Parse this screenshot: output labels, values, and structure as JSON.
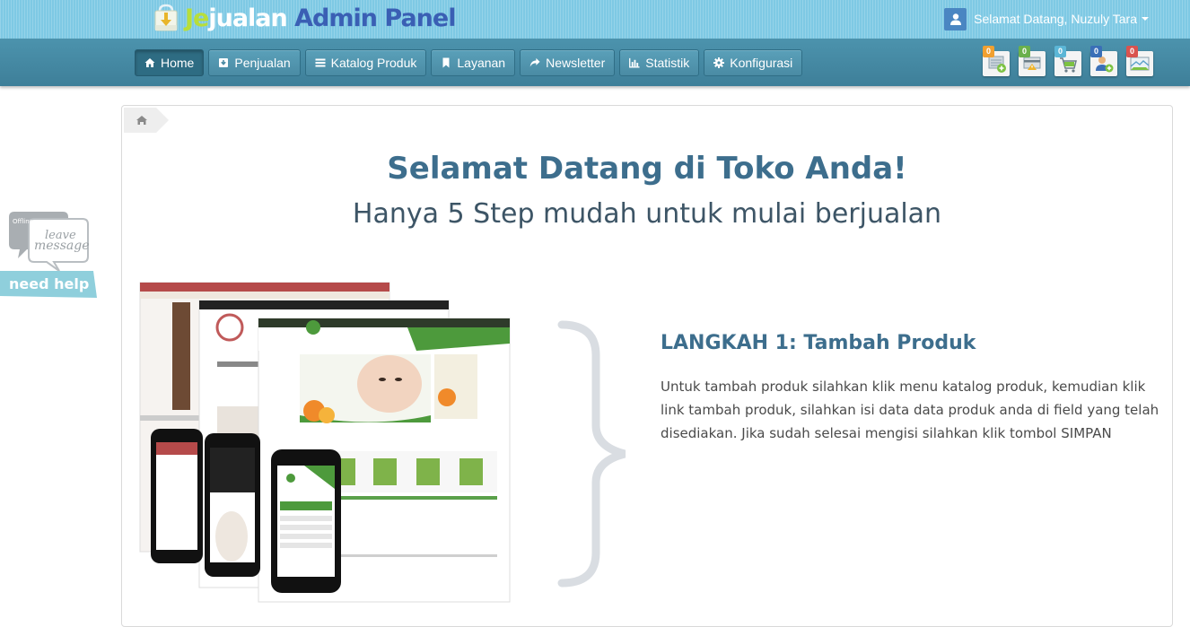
{
  "header": {
    "logo_je": "Je",
    "logo_jualan": "jualan",
    "logo_admin": " Admin Panel",
    "user_greeting": "Selamat Datang, Nuzuly Tara"
  },
  "nav": [
    {
      "label": "Home",
      "icon": "home-icon"
    },
    {
      "label": "Penjualan",
      "icon": "download-box-icon"
    },
    {
      "label": "Katalog Produk",
      "icon": "list-icon"
    },
    {
      "label": "Layanan",
      "icon": "bookmark-icon"
    },
    {
      "label": "Newsletter",
      "icon": "share-arrow-icon"
    },
    {
      "label": "Statistik",
      "icon": "bar-chart-icon"
    },
    {
      "label": "Konfigurasi",
      "icon": "gear-icon"
    }
  ],
  "quick_icons": [
    {
      "badge": "0",
      "color": "#f0a030",
      "icon": "new-order-icon"
    },
    {
      "badge": "0",
      "color": "#6ab04c",
      "icon": "payment-confirm-icon"
    },
    {
      "badge": "0",
      "color": "#5bb6d6",
      "icon": "cart-icon"
    },
    {
      "badge": "0",
      "color": "#3a6fb7",
      "icon": "new-customer-icon"
    },
    {
      "badge": "0",
      "color": "#d9534f",
      "icon": "message-icon"
    }
  ],
  "help_widget": {
    "line1": "Offline",
    "line2": "leave",
    "line3": "message",
    "line4": "need help ?"
  },
  "main": {
    "title": "Selamat Datang di Toko Anda!",
    "subtitle": "Hanya 5 Step mudah untuk mulai berjualan",
    "step_title": "LANGKAH 1: Tambah Produk",
    "step_desc": "Untuk tambah produk silahkan klik menu katalog produk, kemudian klik link tambah produk, silahkan isi data data produk anda di field yang telah disediakan. Jika sudah selesai mengisi silahkan klik tombol SIMPAN"
  },
  "colors": {
    "accent": "#3d6e8d",
    "topbar": "#7ec9e4",
    "navbar": "#4a8ba4"
  }
}
